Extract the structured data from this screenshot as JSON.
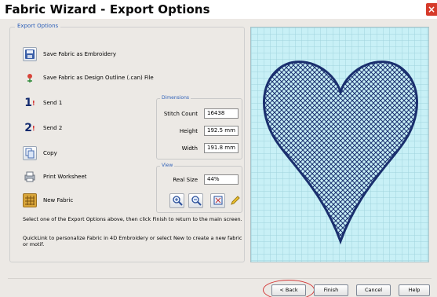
{
  "window": {
    "title": "Fabric Wizard - Export Options",
    "close_glyph": "×"
  },
  "export_options": {
    "group_title": "Export Options",
    "items": [
      {
        "label": "Save Fabric as Embroidery",
        "icon": "floppy-disk-icon"
      },
      {
        "label": "Save Fabric as Design Outline (.can) File",
        "icon": "design-outline-icon"
      },
      {
        "label": "Send 1",
        "icon": "send-1-icon",
        "icon_text": "1"
      },
      {
        "label": "Send 2",
        "icon": "send-2-icon",
        "icon_text": "2"
      },
      {
        "label": "Copy",
        "icon": "copy-icon"
      },
      {
        "label": "Print Worksheet",
        "icon": "printer-icon"
      },
      {
        "label": "New Fabric",
        "icon": "new-fabric-icon"
      }
    ],
    "help_line1": "Select one of the Export Options above, then click Finish to return to the main screen.",
    "help_line2": "QuickLink to personalize Fabric in 4D Embroidery or select New to create a new fabric or motif."
  },
  "dimensions": {
    "title": "Dimensions",
    "stitch_count_label": "Stitch Count",
    "stitch_count_value": "16438",
    "height_label": "Height",
    "height_value": "192.5 mm",
    "width_label": "Width",
    "width_value": "191.8 mm"
  },
  "view": {
    "title": "View",
    "real_size_label": "Real Size",
    "zoom_value": "44%",
    "tools": [
      "zoom-in-icon",
      "zoom-out-icon",
      "fit-view-icon",
      "pencil-icon"
    ]
  },
  "buttons": {
    "back": "< Back",
    "finish": "Finish",
    "cancel": "Cancel",
    "help": "Help"
  },
  "colors": {
    "preview_bg": "#c8f0f6",
    "heart_outline": "#1a2f6e",
    "accent_red": "#d33a3a"
  }
}
